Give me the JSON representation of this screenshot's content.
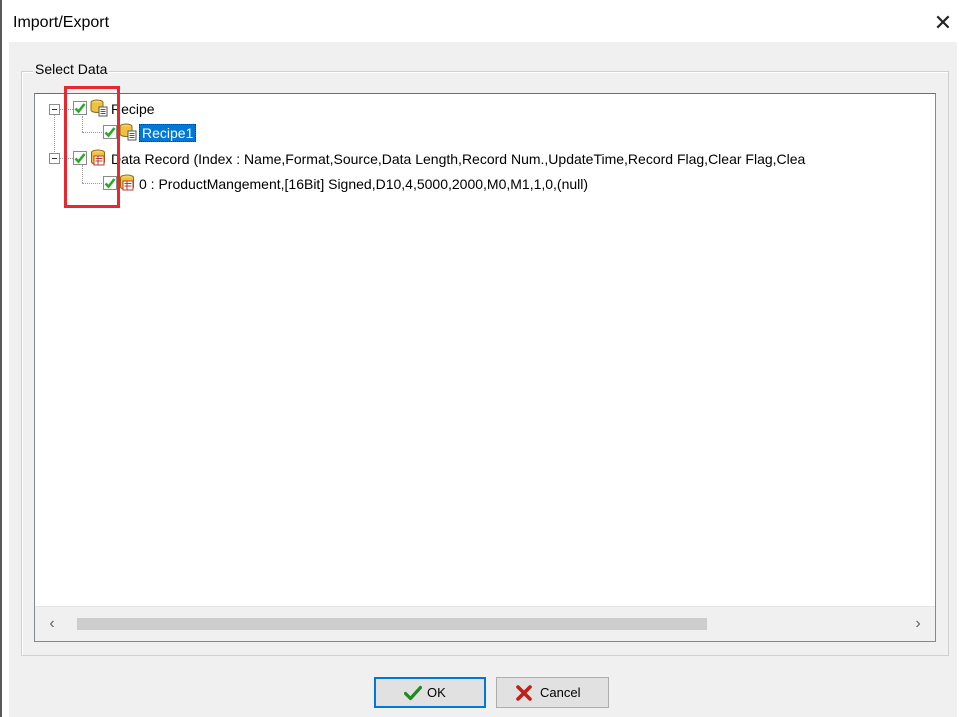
{
  "window": {
    "title": "Import/Export",
    "close_symbol": "✕"
  },
  "group": {
    "label": "Select Data"
  },
  "tree": {
    "nodes": [
      {
        "label": "Recipe",
        "checked": true,
        "expanded": true,
        "icon": "recipe-database-icon",
        "children": [
          {
            "label": "Recipe1",
            "checked": true,
            "selected": true,
            "icon": "recipe-database-icon"
          }
        ]
      },
      {
        "label": "Data Record (Index : Name,Format,Source,Data Length,Record Num.,UpdateTime,Record Flag,Clear Flag,Clea",
        "checked": true,
        "expanded": true,
        "icon": "data-record-icon",
        "children": [
          {
            "label": "0 : ProductMangement,[16Bit] Signed,D10,4,5000,2000,M0,M1,1,0,(null)",
            "checked": true,
            "icon": "data-record-icon"
          }
        ]
      }
    ]
  },
  "scrollbar": {
    "left_arrow": "‹",
    "right_arrow": "›"
  },
  "buttons": {
    "ok_label": "OK",
    "cancel_label": "Cancel"
  },
  "colors": {
    "highlight_box": "#e8282e",
    "selection": "#0078d7",
    "check_green": "#2aa82a"
  }
}
